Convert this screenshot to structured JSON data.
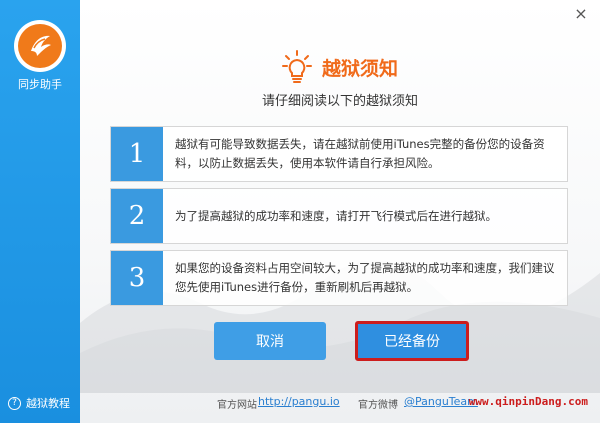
{
  "sidebar": {
    "app_name": "同步助手",
    "help_label": "越狱教程",
    "accent": "#1a8fdf",
    "logo_color": "#f07a1a"
  },
  "window": {
    "close_glyph": "×"
  },
  "header": {
    "title": "越狱须知",
    "subtitle": "请仔细阅读以下的越狱须知",
    "title_color": "#f06a1a"
  },
  "notices": [
    {
      "num": "1",
      "text": "越狱有可能导致数据丢失，请在越狱前使用iTunes完整的备份您的设备资料，以防止数据丢失，使用本软件请自行承担风险。"
    },
    {
      "num": "2",
      "text": "为了提高越狱的成功率和速度，请打开飞行模式后在进行越狱。"
    },
    {
      "num": "3",
      "text": "如果您的设备资料占用空间较大，为了提高越狱的成功率和速度，我们建议您先使用iTunes进行备份，重新刷机后再越狱。"
    }
  ],
  "buttons": {
    "cancel": "取消",
    "confirm": "已经备份"
  },
  "footer": {
    "site_label": "官方网站",
    "site_link": "http://pangu.io",
    "weibo_label": "官方微博",
    "weibo_link": "@PanguTeam",
    "watermark": "www.qinpinDang.com"
  }
}
